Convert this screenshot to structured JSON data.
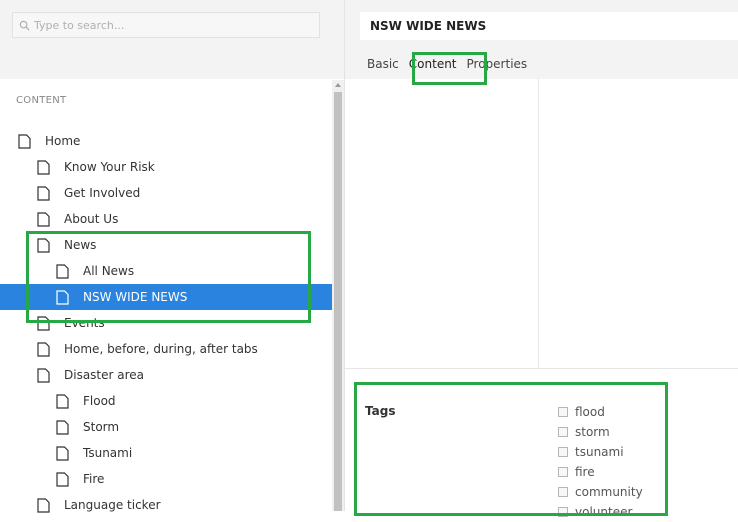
{
  "search": {
    "placeholder": "Type to search..."
  },
  "sidebar": {
    "section_label": "CONTENT",
    "items": [
      {
        "label": "Home"
      },
      {
        "label": "Know Your Risk"
      },
      {
        "label": "Get Involved"
      },
      {
        "label": "About Us"
      },
      {
        "label": "News"
      },
      {
        "label": "All News"
      },
      {
        "label": "NSW WIDE NEWS"
      },
      {
        "label": "Events"
      },
      {
        "label": "Home, before, during, after tabs"
      },
      {
        "label": "Disaster area"
      },
      {
        "label": "Flood"
      },
      {
        "label": "Storm"
      },
      {
        "label": "Tsunami"
      },
      {
        "label": "Fire"
      },
      {
        "label": "Language ticker"
      }
    ]
  },
  "main": {
    "title": "NSW WIDE NEWS",
    "tabs": [
      {
        "label": "Basic"
      },
      {
        "label": "Content"
      },
      {
        "label": "Properties"
      }
    ],
    "tags_label": "Tags",
    "tags": [
      {
        "label": "flood"
      },
      {
        "label": "storm"
      },
      {
        "label": "tsunami"
      },
      {
        "label": "fire"
      },
      {
        "label": "community"
      },
      {
        "label": "volunteer"
      }
    ]
  },
  "colors": {
    "selection": "#2a83de",
    "highlight": "#27a745"
  }
}
